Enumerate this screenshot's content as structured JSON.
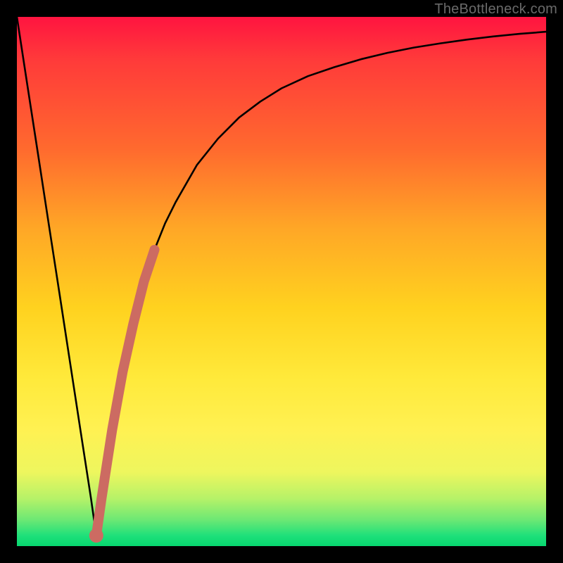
{
  "watermark": "TheBottleneck.com",
  "colors": {
    "curve": "#000000",
    "marker_stroke": "#cc6b62",
    "marker_fill": "#cc6b62",
    "gradient_top": "#ff1440",
    "gradient_bottom": "#07d76f"
  },
  "chart_data": {
    "type": "line",
    "title": "",
    "xlabel": "",
    "ylabel": "",
    "xlim": [
      0,
      100
    ],
    "ylim": [
      0,
      100
    ],
    "grid": false,
    "series": [
      {
        "name": "bottleneck-curve",
        "x": [
          0,
          2,
          4,
          6,
          8,
          10,
          12,
          14,
          15,
          16,
          18,
          20,
          22,
          24,
          26,
          28,
          30,
          34,
          38,
          42,
          46,
          50,
          55,
          60,
          65,
          70,
          75,
          80,
          85,
          90,
          95,
          100
        ],
        "y": [
          100,
          87,
          74,
          61,
          48,
          35,
          22,
          9,
          2,
          9,
          22,
          33,
          42,
          50,
          56,
          61,
          65,
          72,
          77,
          81,
          84,
          86.5,
          88.8,
          90.5,
          92,
          93.2,
          94.2,
          95,
          95.7,
          96.3,
          96.8,
          97.2
        ]
      }
    ],
    "annotations": [
      {
        "name": "highlighted-segment",
        "x": [
          15,
          16,
          18,
          20,
          22,
          24,
          26
        ],
        "y": [
          2,
          9,
          22,
          33,
          42,
          50,
          56
        ]
      },
      {
        "name": "min-marker",
        "x": 15,
        "y": 2
      }
    ]
  }
}
